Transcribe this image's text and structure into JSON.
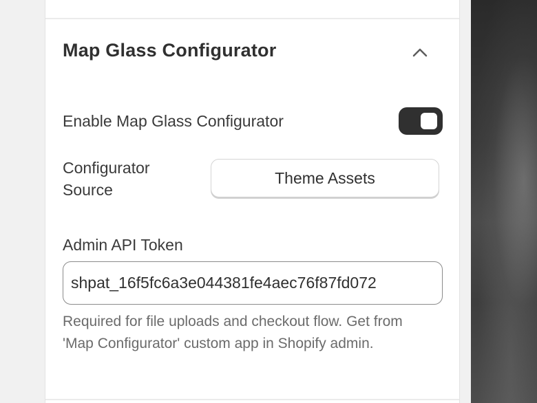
{
  "section": {
    "title": "Map Glass Configurator",
    "collapse_icon": "chevron-up-icon"
  },
  "enable_row": {
    "label": "Enable Map Glass Configurator",
    "enabled": true
  },
  "source_row": {
    "label": "Configurator Source",
    "value": "Theme Assets"
  },
  "token": {
    "label": "Admin API Token",
    "value": "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",
    "help": "Required for file uploads and checkout flow. Get from 'Map Configurator' custom app in Shopify admin."
  },
  "colors": {
    "toggle_on": "#303030",
    "title_text": "#303030",
    "help_text": "#6b6b6b"
  }
}
